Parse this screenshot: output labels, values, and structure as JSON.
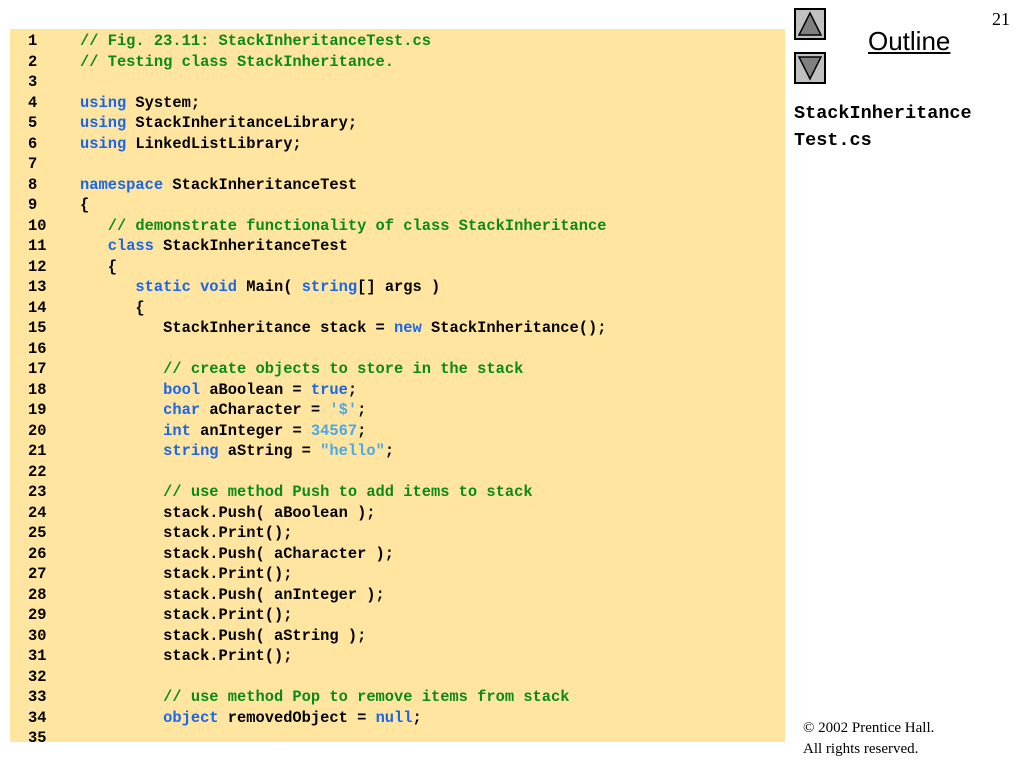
{
  "slide": {
    "number": "21",
    "outline_label": "Outline",
    "file_title_line1": "StackInheritance",
    "file_title_line2": "Test.cs",
    "copyright_line1": "© 2002 Prentice Hall.",
    "copyright_line2": "All rights reserved."
  },
  "nav": {
    "up_icon": "triangle-up-icon",
    "down_icon": "triangle-down-icon"
  },
  "colors": {
    "panel_background": "#ffe5a0",
    "keyword": "#1a66e6",
    "comment": "#0a8a1a",
    "literal": "#4aa8e8"
  },
  "code_lines": [
    {
      "num": "1",
      "tokens": [
        {
          "t": "cm",
          "v": "// Fig. 23.11: StackInheritanceTest.cs"
        }
      ]
    },
    {
      "num": "2",
      "tokens": [
        {
          "t": "cm",
          "v": "// Testing class StackInheritance."
        }
      ]
    },
    {
      "num": "3",
      "tokens": []
    },
    {
      "num": "4",
      "tokens": [
        {
          "t": "kw",
          "v": "using"
        },
        {
          "t": "pl",
          "v": " System;"
        }
      ]
    },
    {
      "num": "5",
      "tokens": [
        {
          "t": "kw",
          "v": "using"
        },
        {
          "t": "pl",
          "v": " StackInheritanceLibrary;"
        }
      ]
    },
    {
      "num": "6",
      "tokens": [
        {
          "t": "kw",
          "v": "using"
        },
        {
          "t": "pl",
          "v": " LinkedListLibrary;"
        }
      ]
    },
    {
      "num": "7",
      "tokens": []
    },
    {
      "num": "8",
      "tokens": [
        {
          "t": "kw",
          "v": "namespace"
        },
        {
          "t": "pl",
          "v": " StackInheritanceTest"
        }
      ]
    },
    {
      "num": "9",
      "tokens": [
        {
          "t": "pl",
          "v": "{"
        }
      ]
    },
    {
      "num": "10",
      "tokens": [
        {
          "t": "pl",
          "v": "   "
        },
        {
          "t": "cm",
          "v": "// demonstrate functionality of class StackInheritance"
        }
      ]
    },
    {
      "num": "11",
      "tokens": [
        {
          "t": "pl",
          "v": "   "
        },
        {
          "t": "kw",
          "v": "class"
        },
        {
          "t": "pl",
          "v": " StackInheritanceTest"
        }
      ]
    },
    {
      "num": "12",
      "tokens": [
        {
          "t": "pl",
          "v": "   {"
        }
      ]
    },
    {
      "num": "13",
      "tokens": [
        {
          "t": "pl",
          "v": "      "
        },
        {
          "t": "kw",
          "v": "static void"
        },
        {
          "t": "pl",
          "v": " Main( "
        },
        {
          "t": "kw",
          "v": "string"
        },
        {
          "t": "pl",
          "v": "[] args )"
        }
      ]
    },
    {
      "num": "14",
      "tokens": [
        {
          "t": "pl",
          "v": "      {"
        }
      ]
    },
    {
      "num": "15",
      "tokens": [
        {
          "t": "pl",
          "v": "         StackInheritance stack = "
        },
        {
          "t": "kw",
          "v": "new"
        },
        {
          "t": "pl",
          "v": " StackInheritance();"
        }
      ]
    },
    {
      "num": "16",
      "tokens": []
    },
    {
      "num": "17",
      "tokens": [
        {
          "t": "pl",
          "v": "         "
        },
        {
          "t": "cm",
          "v": "// create objects to store in the stack"
        }
      ]
    },
    {
      "num": "18",
      "tokens": [
        {
          "t": "pl",
          "v": "         "
        },
        {
          "t": "kw",
          "v": "bool"
        },
        {
          "t": "pl",
          "v": " aBoolean = "
        },
        {
          "t": "kw",
          "v": "true"
        },
        {
          "t": "pl",
          "v": ";"
        }
      ]
    },
    {
      "num": "19",
      "tokens": [
        {
          "t": "pl",
          "v": "         "
        },
        {
          "t": "kw",
          "v": "char"
        },
        {
          "t": "pl",
          "v": " aCharacter = "
        },
        {
          "t": "st",
          "v": "'$'"
        },
        {
          "t": "pl",
          "v": ";"
        }
      ]
    },
    {
      "num": "20",
      "tokens": [
        {
          "t": "pl",
          "v": "         "
        },
        {
          "t": "kw",
          "v": "int"
        },
        {
          "t": "pl",
          "v": " anInteger = "
        },
        {
          "t": "nu",
          "v": "34567"
        },
        {
          "t": "pl",
          "v": ";"
        }
      ]
    },
    {
      "num": "21",
      "tokens": [
        {
          "t": "pl",
          "v": "         "
        },
        {
          "t": "kw",
          "v": "string"
        },
        {
          "t": "pl",
          "v": " aString = "
        },
        {
          "t": "st",
          "v": "\"hello\""
        },
        {
          "t": "pl",
          "v": ";"
        }
      ]
    },
    {
      "num": "22",
      "tokens": []
    },
    {
      "num": "23",
      "tokens": [
        {
          "t": "pl",
          "v": "         "
        },
        {
          "t": "cm",
          "v": "// use method Push to add items to stack"
        }
      ]
    },
    {
      "num": "24",
      "tokens": [
        {
          "t": "pl",
          "v": "         stack.Push( aBoolean );"
        }
      ]
    },
    {
      "num": "25",
      "tokens": [
        {
          "t": "pl",
          "v": "         stack.Print();"
        }
      ]
    },
    {
      "num": "26",
      "tokens": [
        {
          "t": "pl",
          "v": "         stack.Push( aCharacter );"
        }
      ]
    },
    {
      "num": "27",
      "tokens": [
        {
          "t": "pl",
          "v": "         stack.Print();"
        }
      ]
    },
    {
      "num": "28",
      "tokens": [
        {
          "t": "pl",
          "v": "         stack.Push( anInteger );"
        }
      ]
    },
    {
      "num": "29",
      "tokens": [
        {
          "t": "pl",
          "v": "         stack.Print();"
        }
      ]
    },
    {
      "num": "30",
      "tokens": [
        {
          "t": "pl",
          "v": "         stack.Push( aString );"
        }
      ]
    },
    {
      "num": "31",
      "tokens": [
        {
          "t": "pl",
          "v": "         stack.Print();"
        }
      ]
    },
    {
      "num": "32",
      "tokens": []
    },
    {
      "num": "33",
      "tokens": [
        {
          "t": "pl",
          "v": "         "
        },
        {
          "t": "cm",
          "v": "// use method Pop to remove items from stack"
        }
      ]
    },
    {
      "num": "34",
      "tokens": [
        {
          "t": "pl",
          "v": "         "
        },
        {
          "t": "kw",
          "v": "object"
        },
        {
          "t": "pl",
          "v": " removedObject = "
        },
        {
          "t": "kw",
          "v": "null"
        },
        {
          "t": "pl",
          "v": ";"
        }
      ]
    },
    {
      "num": "35",
      "tokens": []
    }
  ]
}
